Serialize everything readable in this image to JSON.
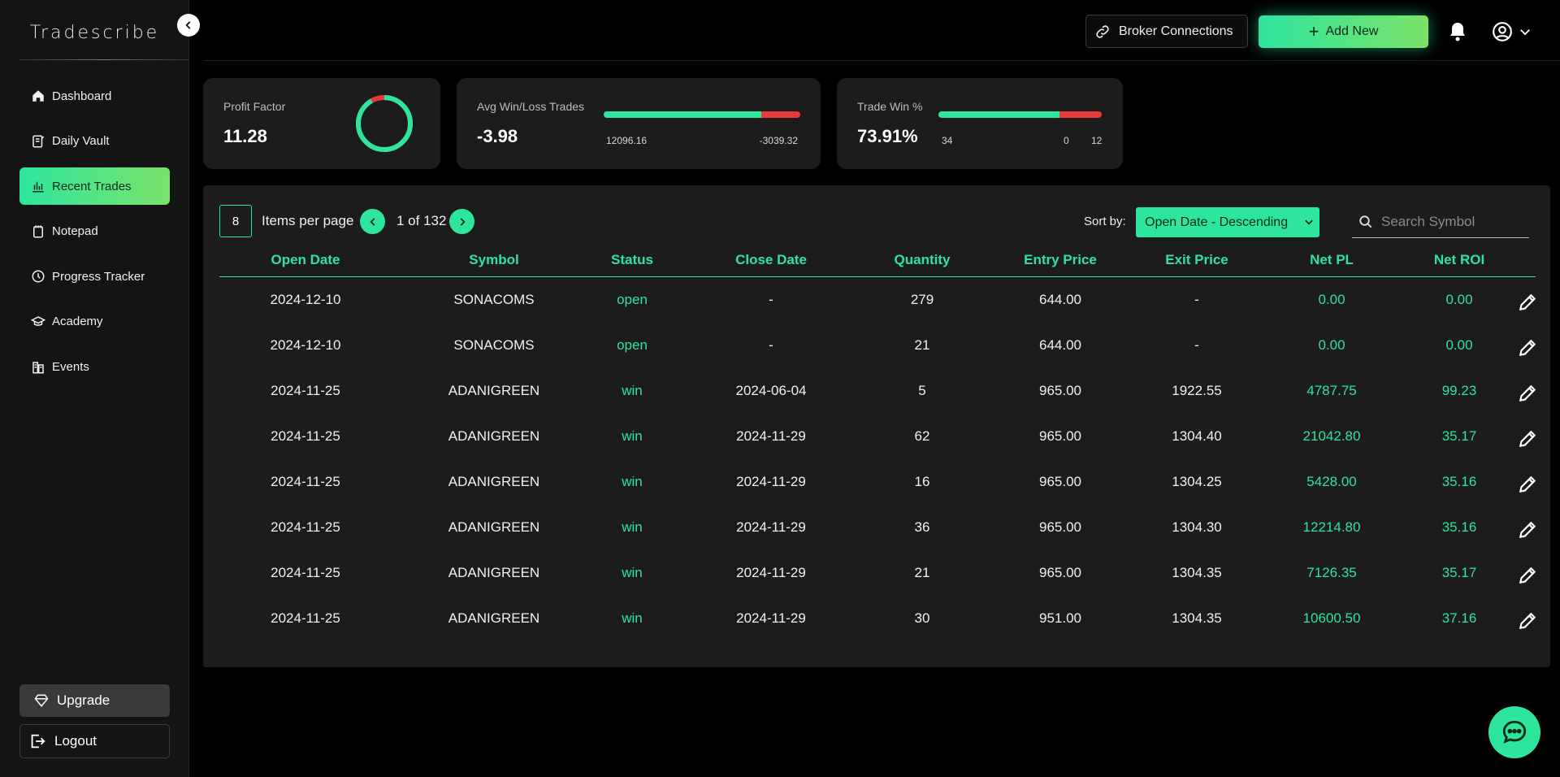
{
  "app": {
    "brand": "Tradescribe"
  },
  "sidebar": {
    "items": [
      {
        "label": "Dashboard",
        "icon": "home-icon"
      },
      {
        "label": "Daily Vault",
        "icon": "journal-icon"
      },
      {
        "label": "Recent Trades",
        "icon": "bar-chart-icon",
        "active": true
      },
      {
        "label": "Notepad",
        "icon": "notepad-icon"
      },
      {
        "label": "Progress Tracker",
        "icon": "clock-icon"
      },
      {
        "label": "Academy",
        "icon": "graduation-cap-icon"
      },
      {
        "label": "Events",
        "icon": "events-icon"
      }
    ],
    "upgrade_label": "Upgrade",
    "logout_label": "Logout"
  },
  "header": {
    "broker_label": "Broker Connections",
    "add_new_label": "Add New"
  },
  "stats": {
    "profit_factor": {
      "label": "Profit Factor",
      "value": "11.28",
      "ring_win_fraction": 0.918
    },
    "avg_win_loss": {
      "label": "Avg Win/Loss Trades",
      "value": "-3.98",
      "win": "12096.16",
      "loss": "-3039.32",
      "win_fraction": 0.8
    },
    "trade_win": {
      "label": "Trade Win %",
      "value": "73.91%",
      "wins": "34",
      "breakeven": "0",
      "losses": "12",
      "win_fraction": 0.74
    }
  },
  "table_controls": {
    "items_per_page": "8",
    "items_per_page_label": "Items per page",
    "page_text": "1 of 132",
    "sort_label": "Sort by:",
    "sort_value": "Open Date - Descending",
    "search_placeholder": "Search Symbol"
  },
  "table": {
    "columns": [
      "Open Date",
      "Symbol",
      "Status",
      "Close Date",
      "Quantity",
      "Entry Price",
      "Exit Price",
      "Net PL",
      "Net ROI"
    ],
    "rows": [
      [
        "2024-12-10",
        "SONACOMS",
        "open",
        "-",
        "279",
        "644.00",
        "-",
        "0.00",
        "0.00"
      ],
      [
        "2024-12-10",
        "SONACOMS",
        "open",
        "-",
        "21",
        "644.00",
        "-",
        "0.00",
        "0.00"
      ],
      [
        "2024-11-25",
        "ADANIGREEN",
        "win",
        "2024-06-04",
        "5",
        "965.00",
        "1922.55",
        "4787.75",
        "99.23"
      ],
      [
        "2024-11-25",
        "ADANIGREEN",
        "win",
        "2024-11-29",
        "62",
        "965.00",
        "1304.40",
        "21042.80",
        "35.17"
      ],
      [
        "2024-11-25",
        "ADANIGREEN",
        "win",
        "2024-11-29",
        "16",
        "965.00",
        "1304.25",
        "5428.00",
        "35.16"
      ],
      [
        "2024-11-25",
        "ADANIGREEN",
        "win",
        "2024-11-29",
        "36",
        "965.00",
        "1304.30",
        "12214.80",
        "35.16"
      ],
      [
        "2024-11-25",
        "ADANIGREEN",
        "win",
        "2024-11-29",
        "21",
        "965.00",
        "1304.35",
        "7126.35",
        "35.17"
      ],
      [
        "2024-11-25",
        "ADANIGREEN",
        "win",
        "2024-11-29",
        "30",
        "951.00",
        "1304.35",
        "10600.50",
        "37.16"
      ]
    ]
  },
  "colors": {
    "accent": "#2ee59d",
    "accent2": "#7be36a",
    "loss": "#e83a3a",
    "card": "#1c1c1c"
  }
}
